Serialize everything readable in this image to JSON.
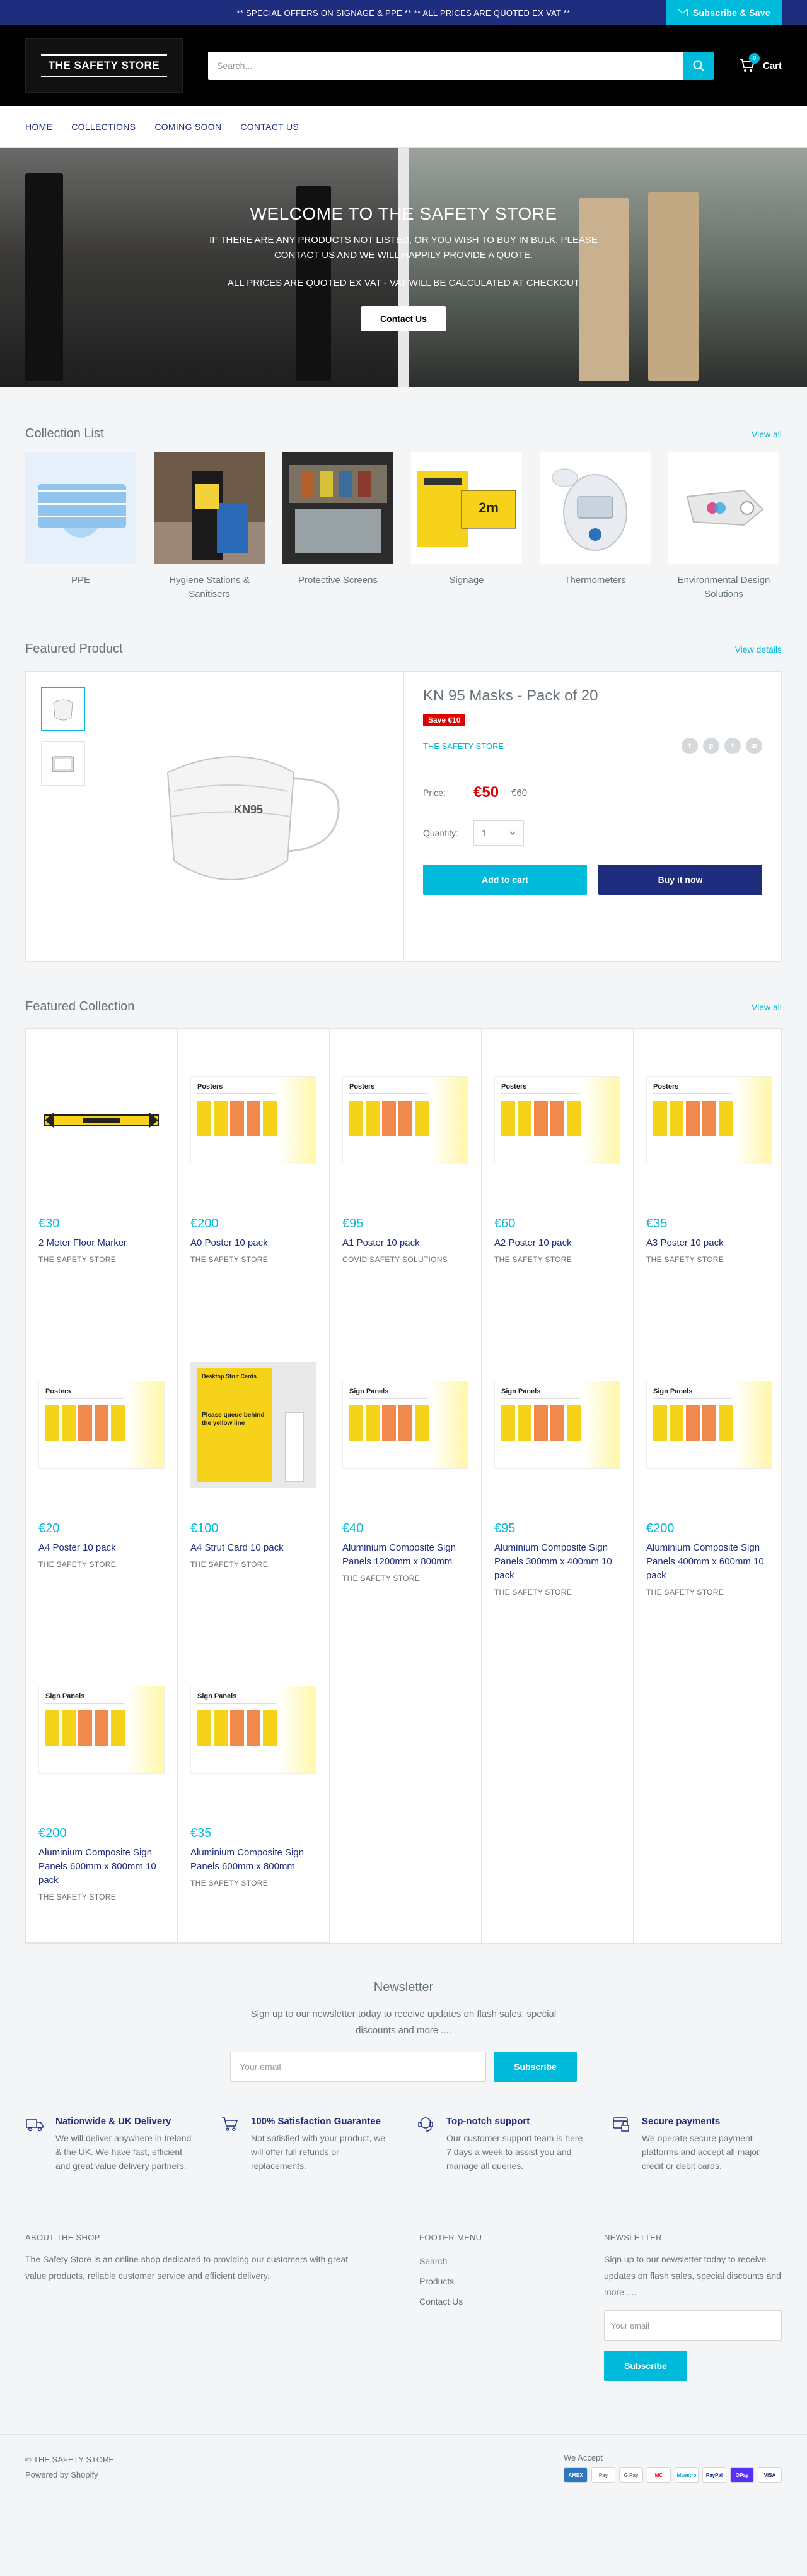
{
  "announcement": {
    "text": "** SPECIAL OFFERS ON SIGNAGE & PPE ** ** ALL PRICES ARE QUOTED EX VAT **",
    "subscribe_label": "Subscribe & Save"
  },
  "header": {
    "logo_text": "THE SAFETY STORE",
    "search_placeholder": "Search...",
    "cart_label": "Cart",
    "cart_count": "0"
  },
  "nav": [
    "HOME",
    "COLLECTIONS",
    "COMING SOON",
    "CONTACT US"
  ],
  "hero": {
    "title": "WELCOME TO THE SAFETY STORE",
    "line1": "IF THERE ARE ANY PRODUCTS NOT LISTED, OR YOU WISH TO BUY IN BULK, PLEASE CONTACT US AND WE WILL HAPPILY PROVIDE A QUOTE.",
    "line2": "ALL PRICES ARE QUOTED EX VAT - VAT WILL BE CALCULATED AT CHECKOUT",
    "cta": "Contact Us"
  },
  "collection_list": {
    "title": "Collection List",
    "view_all": "View all",
    "items": [
      {
        "name": "PPE"
      },
      {
        "name": "Hygiene Stations & Sanitisers"
      },
      {
        "name": "Protective Screens"
      },
      {
        "name": "Signage"
      },
      {
        "name": "Thermometers"
      },
      {
        "name": "Environmental Design Solutions"
      }
    ]
  },
  "featured_product": {
    "section_title": "Featured Product",
    "view_details": "View details",
    "title": "KN 95 Masks - Pack of 20",
    "save_badge": "Save €10",
    "vendor": "THE SAFETY STORE",
    "price_label": "Price:",
    "price": "€50",
    "compare_price": "€60",
    "quantity_label": "Quantity:",
    "quantity": "1",
    "add_to_cart": "Add to cart",
    "buy_now": "Buy it now",
    "image_text": "KN95"
  },
  "featured_collection": {
    "title": "Featured Collection",
    "view_all": "View all",
    "products": [
      {
        "price": "€30",
        "name": "2 Meter Floor Marker",
        "vendor": "THE SAFETY STORE",
        "img": "marker"
      },
      {
        "price": "€200",
        "name": "A0 Poster 10 pack",
        "vendor": "THE SAFETY STORE",
        "img": "poster"
      },
      {
        "price": "€95",
        "name": "A1 Poster 10 pack",
        "vendor": "COVID SAFETY SOLUTIONS",
        "img": "poster"
      },
      {
        "price": "€60",
        "name": "A2 Poster 10 pack",
        "vendor": "THE SAFETY STORE",
        "img": "poster"
      },
      {
        "price": "€35",
        "name": "A3 Poster 10 pack",
        "vendor": "THE SAFETY STORE",
        "img": "poster"
      },
      {
        "price": "€20",
        "name": "A4 Poster 10 pack",
        "vendor": "THE SAFETY STORE",
        "img": "poster"
      },
      {
        "price": "€100",
        "name": "A4 Strut Card 10 pack",
        "vendor": "THE SAFETY STORE",
        "img": "strut"
      },
      {
        "price": "€40",
        "name": "Aluminium Composite Sign Panels 1200mm x 800mm",
        "vendor": "THE SAFETY STORE",
        "img": "panel"
      },
      {
        "price": "€95",
        "name": "Aluminium Composite Sign Panels 300mm x 400mm 10 pack",
        "vendor": "THE SAFETY STORE",
        "img": "panel"
      },
      {
        "price": "€200",
        "name": "Aluminium Composite Sign Panels 400mm x 600mm 10 pack",
        "vendor": "THE SAFETY STORE",
        "img": "panel"
      },
      {
        "price": "€200",
        "name": "Aluminium Composite Sign Panels 600mm x 800mm 10 pack",
        "vendor": "THE SAFETY STORE",
        "img": "panel"
      },
      {
        "price": "€35",
        "name": "Aluminium Composite Sign Panels 600mm x 800mm",
        "vendor": "THE SAFETY STORE",
        "img": "panel"
      }
    ],
    "poster_heading": "Posters",
    "panel_heading": "Sign Panels",
    "strut_heading": "Desktop Strut Cards",
    "strut_text": "Please queue behind the yellow line"
  },
  "newsletter": {
    "title": "Newsletter",
    "text": "Sign up to our newsletter today to receive updates on flash sales, special discounts and more ....",
    "placeholder": "Your email",
    "button": "Subscribe"
  },
  "features": [
    {
      "title": "Nationwide & UK Delivery",
      "text": "We will deliver anywhere in Ireland & the UK. We have fast, efficient and great value delivery partners.",
      "icon": "delivery-icon"
    },
    {
      "title": "100% Satisfaction Guarantee",
      "text": "Not satisfied with your product, we will offer full refunds or replacements.",
      "icon": "cart-icon"
    },
    {
      "title": "Top-notch support",
      "text": "Our customer support team is here 7 days a week to assist you and manage all queries.",
      "icon": "support-icon"
    },
    {
      "title": "Secure payments",
      "text": "We operate secure payment platforms and accept all major credit or debit cards.",
      "icon": "secure-payment-icon"
    }
  ],
  "footer": {
    "about_title": "ABOUT THE SHOP",
    "about_text": "The Safety Store is an online shop dedicated to providing our customers with great value products, reliable customer service and efficient delivery.",
    "menu_title": "FOOTER MENU",
    "menu": [
      "Search",
      "Products",
      "Contact Us"
    ],
    "newsletter_title": "NEWSLETTER",
    "newsletter_text": "Sign up to our newsletter today to receive updates on flash sales, special discounts and more ....",
    "placeholder": "Your email",
    "button": "Subscribe",
    "copyright": "© THE SAFETY STORE",
    "powered": "Powered by Shopify",
    "we_accept": "We Accept",
    "payments": [
      "AMEX",
      "Pay",
      "G Pay",
      "MC",
      "Maestro",
      "PayPal",
      "OPay",
      "VISA"
    ]
  },
  "colors": {
    "navy": "#1e2d7d",
    "accent": "#00badb",
    "sale": "#e00000",
    "text": "#677279"
  }
}
